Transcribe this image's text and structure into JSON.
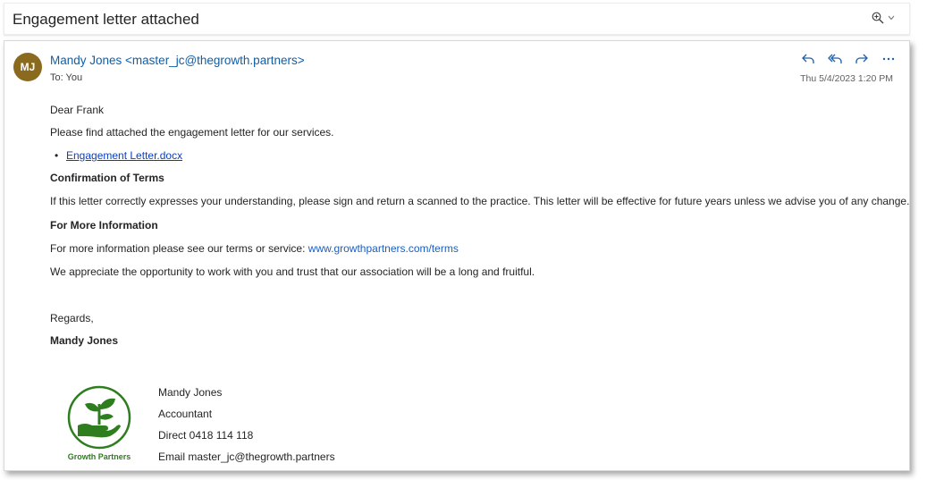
{
  "subject": "Engagement letter attached",
  "icons": {
    "zoom": "zoom-in-icon",
    "dropdown": "chevron-down-icon"
  },
  "colors": {
    "avatar_bg": "#8a6a1f",
    "link": "#0f5fa8",
    "brand_green": "#2e7d1e"
  },
  "message": {
    "avatar_initials": "MJ",
    "sender": "Mandy Jones <master_jc@thegrowth.partners>",
    "to": "To:  You",
    "date": "Thu 5/4/2023 1:20 PM",
    "actions": [
      "reply-icon",
      "reply-all-icon",
      "forward-icon",
      "more-icon"
    ]
  },
  "body": {
    "greeting": "Dear Frank",
    "intro": "Please find attached the engagement letter for our services.",
    "attachment": "Engagement Letter.docx",
    "heading1": "Confirmation of Terms",
    "para1": "If this letter correctly expresses your understanding, please sign and return a scanned to the practice. This letter will be effective for future years unless we advise you of any change.",
    "heading2": "For More Information",
    "para2_prefix": "For more information please see our terms or service: ",
    "para2_link": "www.growthpartners.com/terms",
    "para3": "We appreciate the opportunity to work with you and trust that our association will be a long and fruitful.",
    "closing": "Regards,",
    "closing_name": "Mandy Jones"
  },
  "signature": {
    "logo_text": "Growth Partners",
    "name": "Mandy Jones",
    "title": "Accountant",
    "phone": "Direct 0418 114 118",
    "email": "Email master_jc@thegrowth.partners"
  }
}
